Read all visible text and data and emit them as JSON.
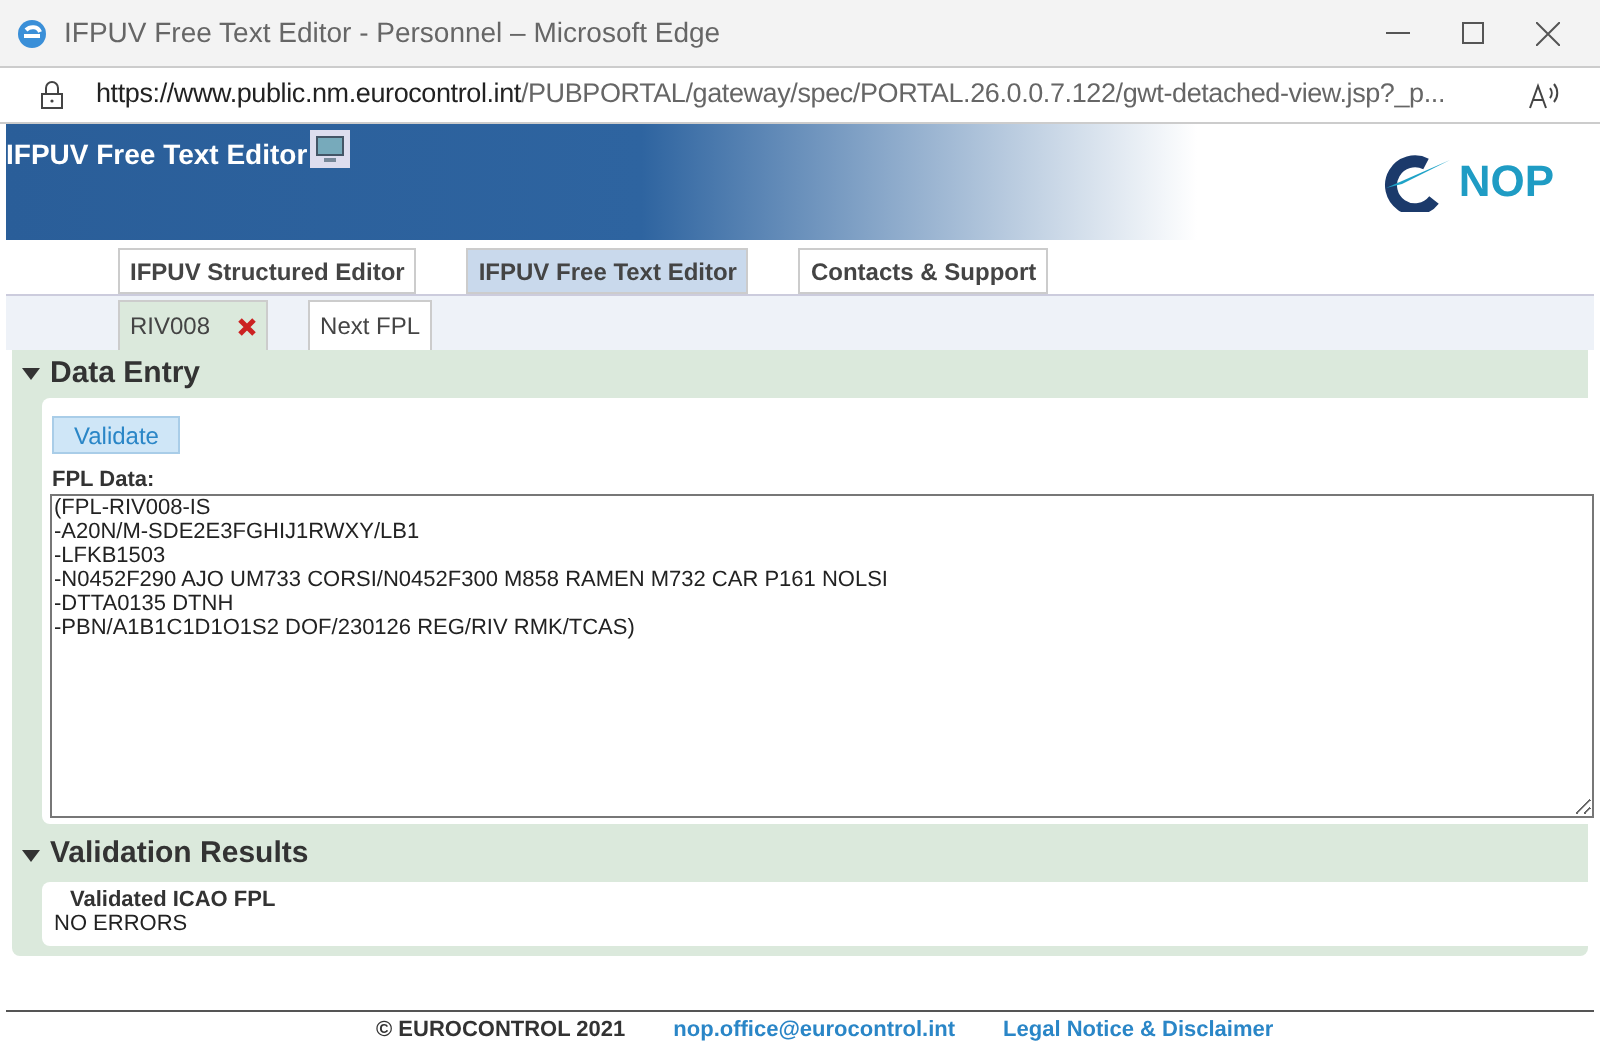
{
  "window": {
    "title": "IFPUV Free Text Editor - Personnel – Microsoft Edge"
  },
  "address_bar": {
    "url_host": "https://www.public.nm.eurocontrol.int",
    "url_path": "/PUBPORTAL/gateway/spec/PORTAL.26.0.0.7.122/gwt-detached-view.jsp?_p..."
  },
  "header": {
    "title": "IFPUV Free Text Editor",
    "logo_text": "NOP"
  },
  "tabs": [
    {
      "label": "IFPUV Structured Editor",
      "selected": false
    },
    {
      "label": "IFPUV Free Text Editor",
      "selected": true
    },
    {
      "label": "Contacts & Support",
      "selected": false
    }
  ],
  "subtabs": [
    {
      "label": "RIV008",
      "selected": true,
      "closable": true
    },
    {
      "label": "Next FPL",
      "selected": false,
      "closable": false
    }
  ],
  "data_entry": {
    "title": "Data Entry",
    "expanded": true,
    "validate_button": "Validate",
    "field_label": "FPL Data:",
    "value": "(FPL-RIV008-IS\n-A20N/M-SDE2E3FGHIJ1RWXY/LB1\n-LFKB1503\n-N0452F290 AJO UM733 CORSI/N0452F300 M858 RAMEN M732 CAR P161 NOLSI\n-DTTA0135 DTNH\n-PBN/A1B1C1D1O1S2 DOF/230126 REG/RIV RMK/TCAS)"
  },
  "validation_results": {
    "title": "Validation Results",
    "expanded": true,
    "heading": "Validated ICAO FPL",
    "message": "NO ERRORS"
  },
  "footer": {
    "copyright": "© EUROCONTROL 2021",
    "email": "nop.office@eurocontrol.int",
    "legal": "Legal Notice & Disclaimer"
  }
}
